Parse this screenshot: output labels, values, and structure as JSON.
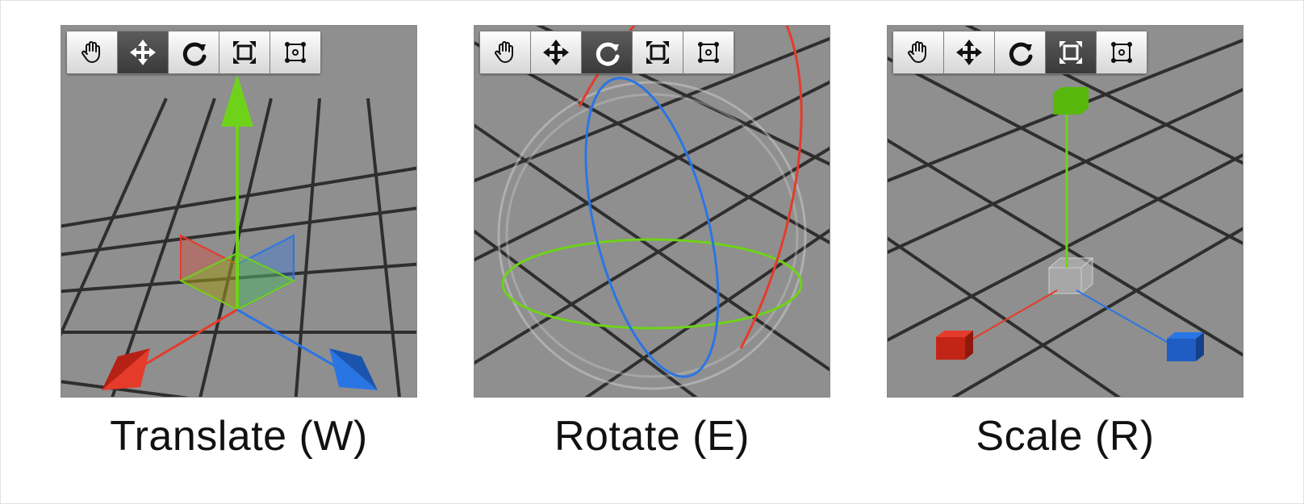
{
  "panels": [
    {
      "id": "translate",
      "caption": "Translate (W)",
      "active_tool": "move",
      "gizmo": "translate"
    },
    {
      "id": "rotate",
      "caption": "Rotate (E)",
      "active_tool": "rotate",
      "gizmo": "rotate"
    },
    {
      "id": "scale",
      "caption": "Scale (R)",
      "active_tool": "scale",
      "gizmo": "scale"
    }
  ],
  "tools": [
    {
      "id": "hand",
      "name": "hand-tool"
    },
    {
      "id": "move",
      "name": "move-tool"
    },
    {
      "id": "rotate",
      "name": "rotate-tool"
    },
    {
      "id": "scale",
      "name": "scale-tool"
    },
    {
      "id": "rect",
      "name": "rect-tool"
    }
  ],
  "icons": {
    "hand": "hand-icon",
    "move": "move-icon",
    "rotate": "rotate-icon",
    "scale": "scale-icon",
    "rect": "rect-icon"
  },
  "axis_colors": {
    "x": "#e43b2a",
    "y": "#6fd21a",
    "z": "#2a75e4"
  },
  "grid_color": "#8f8f8f",
  "grid_line": "#2e2e2e"
}
